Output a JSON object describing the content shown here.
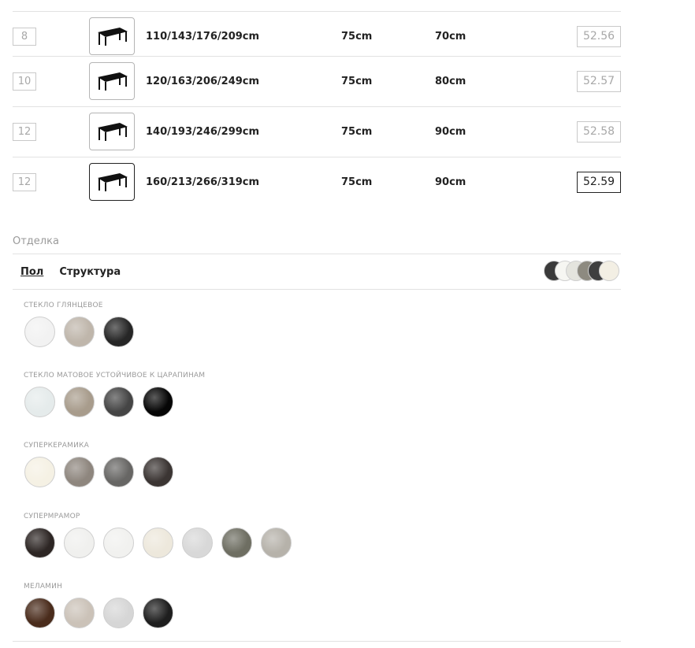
{
  "table": {
    "rows": [
      {
        "seats": "8",
        "length": "110/143/176/209cm",
        "height": "75cm",
        "width": "70cm",
        "code": "52.56",
        "active": false
      },
      {
        "seats": "10",
        "length": "120/163/206/249cm",
        "height": "75cm",
        "width": "80cm",
        "code": "52.57",
        "active": false
      },
      {
        "seats": "12",
        "length": "140/193/246/299cm",
        "height": "75cm",
        "width": "90cm",
        "code": "52.58",
        "active": false
      },
      {
        "seats": "12",
        "length": "160/213/266/319cm",
        "height": "75cm",
        "width": "90cm",
        "code": "52.59",
        "active": true
      }
    ]
  },
  "finish": {
    "title": "Отделка",
    "tabs": [
      {
        "label": "Пол",
        "active": true
      },
      {
        "label": "Структура",
        "active": false
      }
    ],
    "stack_colors": [
      "#3a3a3a",
      "#f6f6f2",
      "#e4e4de",
      "#8d8a80",
      "#3f3f3f",
      "#f3efe4"
    ],
    "groups": [
      {
        "label": "стекло глянцевое",
        "colors": [
          "#f2f2f2",
          "#bfb6ab",
          "#262626"
        ]
      },
      {
        "label": "стекло матовое устойчивое к царапинам",
        "colors": [
          "#e5ebeb",
          "#a89c8c",
          "#454545",
          "#060606"
        ]
      },
      {
        "label": "суперкерамика",
        "colors": [
          "#f5f1e4",
          "#8e867e",
          "#676664",
          "#3b3533"
        ]
      },
      {
        "label": "супермрамор",
        "colors": [
          "#2d2624",
          "#f0f0ee",
          "#f1f1ef",
          "#ede8dc",
          "#d8d8d8",
          "#6e6e62",
          "#b6b2aa"
        ]
      },
      {
        "label": "меламин",
        "colors": [
          "#4a2c1c",
          "#cbc2b8",
          "#d6d6d6",
          "#1e1e1e"
        ]
      }
    ]
  }
}
